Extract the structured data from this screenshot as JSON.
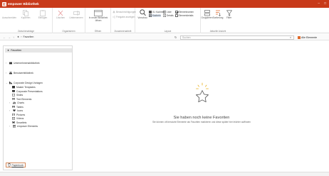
{
  "window": {
    "title": "empower Bibliothek",
    "controls": [
      "–",
      "□"
    ]
  },
  "ribbon": {
    "groups": {
      "clipboard": {
        "name": "Zwischenablage",
        "buttons": [
          "Ausschneiden",
          "Kopieren",
          "Einfügen"
        ]
      },
      "organize": {
        "name": "Organisieren",
        "buttons": [
          "Löschen",
          "Umbenennen"
        ]
      },
      "open": {
        "name": "Öffnen",
        "button": "In neuer Bibliothek öffnen"
      },
      "favorites": {
        "name": "Zusammenarbeit",
        "items": [
          "Benachrichtigungen",
          "Freigabe anzeigen"
        ]
      },
      "layout": {
        "name": "Layout",
        "preview": "Vorschau",
        "views": [
          "XL Kacheln",
          "Kacheln",
          "Liste",
          "Details"
        ],
        "checks": [
          {
            "label": "Elementnamen",
            "checked": true
          },
          {
            "label": "Elementdetails",
            "checked": false
          }
        ]
      },
      "current_view": {
        "name": "Aktuelle Ansicht",
        "buttons": [
          "Gruppieren",
          "Sortierung",
          "Filter"
        ]
      }
    }
  },
  "navbar": {
    "breadcrumb": "Favoriten",
    "search_placeholder": "Suchen",
    "scope": "Alle Elemente"
  },
  "sidebar": {
    "favorites": "Favoriten",
    "items": [
      {
        "label": "Unternehmensbibliothek",
        "level": 0,
        "chevron": "›"
      },
      {
        "label": "Benutzerbibliothek",
        "level": 0,
        "chevron": "›"
      },
      {
        "label": "Corporate Design Vorlagen",
        "level": 0,
        "chevron": "⌄"
      },
      {
        "label": "Master Templates",
        "level": 1,
        "chevron": ""
      },
      {
        "label": "Corporate Presentations",
        "level": 1,
        "chevron": ""
      },
      {
        "label": "Slides",
        "level": 1,
        "chevron": ""
      },
      {
        "label": "Text Elements",
        "level": 1,
        "chevron": ""
      },
      {
        "label": "Charts",
        "level": 1,
        "chevron": "›"
      },
      {
        "label": "Tables",
        "level": 1,
        "chevron": ""
      },
      {
        "label": "Icons",
        "level": 1,
        "chevron": "›"
      },
      {
        "label": "Pictures",
        "level": 1,
        "chevron": ""
      },
      {
        "label": "Videos",
        "level": 1,
        "chevron": ""
      },
      {
        "label": "Smartlets",
        "level": 1,
        "chevron": ""
      },
      {
        "label": "empower Elements",
        "level": 1,
        "chevron": "›"
      }
    ],
    "papierkorb": "Papierkorb"
  },
  "empty_state": {
    "title": "Sie haben noch keine Favoriten",
    "subtitle": "Sie können oft benutzte Elemente als Favoriten markieren und diese später hier leichter auffinden"
  },
  "colors": {
    "brand": "#c83a1a",
    "accent": "#e06a2b"
  }
}
